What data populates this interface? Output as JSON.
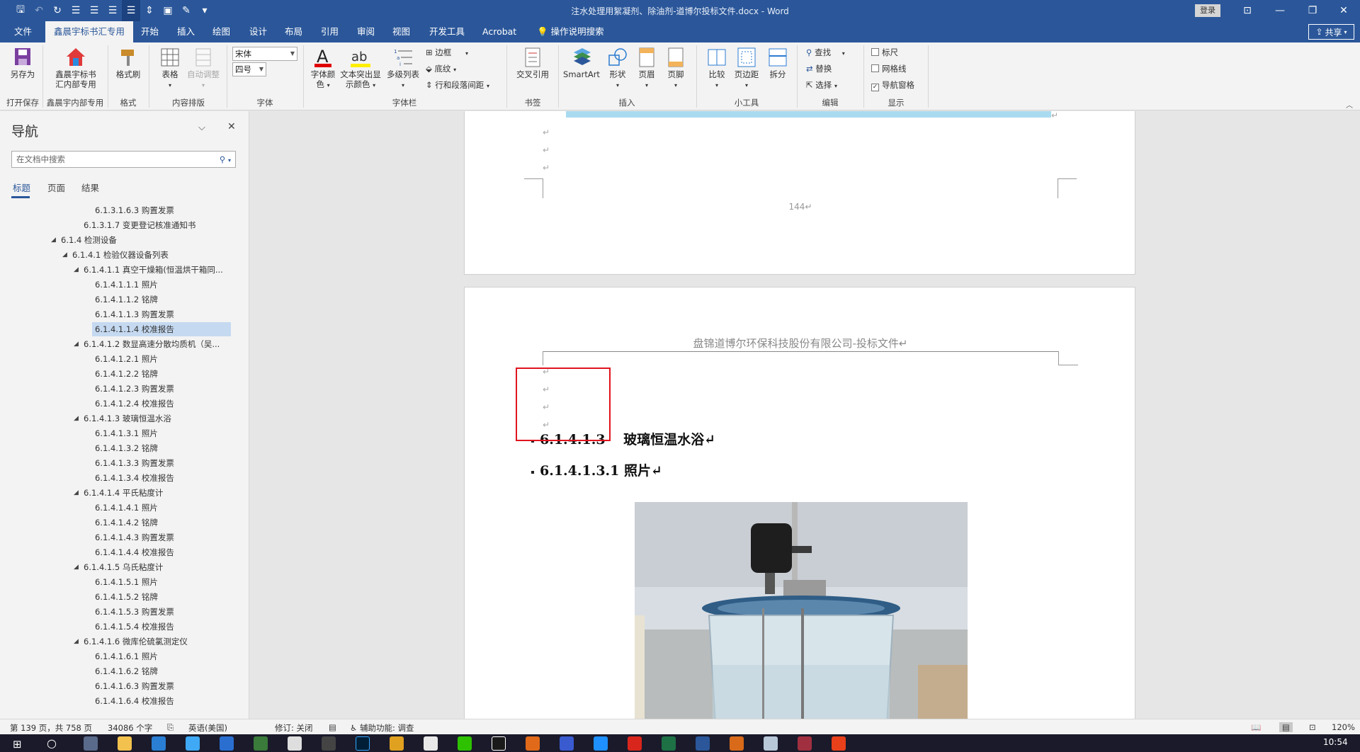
{
  "window": {
    "title": "注水处理用絮凝剂、除油剂-道博尔投标文件.docx  -  Word",
    "login": "登录",
    "share": "共享"
  },
  "tabs": [
    "文件",
    "鑫晨宇标书汇专用",
    "开始",
    "插入",
    "绘图",
    "设计",
    "布局",
    "引用",
    "审阅",
    "视图",
    "开发工具",
    "Acrobat",
    "操作说明搜索"
  ],
  "ribbon": {
    "saveas": "另存为",
    "xcy_line1": "鑫晨宇标书",
    "xcy_line2": "汇内部专用",
    "formatpainter": "格式刷",
    "table": "表格",
    "autoadjust": "自动调整",
    "font_name": "宋体",
    "font_size": "四号",
    "fontcolor_l1": "字体颜",
    "fontcolor_l2": "色",
    "highlight_l1": "文本突出显",
    "highlight_l2": "示颜色",
    "multilevel": "多级列表",
    "border": "边框",
    "shading": "底纹",
    "linespacing": "行和段落间距",
    "crossref": "交叉引用",
    "smartart": "SmartArt",
    "shapes": "形状",
    "header": "页眉",
    "footer": "页脚",
    "compare": "比较",
    "margins": "页边距",
    "split": "拆分",
    "find": "查找",
    "replace": "替换",
    "select": "选择",
    "ruler": "标尺",
    "gridlines": "网格线",
    "navpane": "导航窗格",
    "groups": {
      "open": "打开保存",
      "xcy": "鑫晨宇内部专用",
      "format": "格式",
      "layout": "内容排版",
      "font": "字体",
      "para": "字体栏",
      "bookmark": "书签",
      "insert": "插入",
      "tools": "小工具",
      "edit": "编辑",
      "show": "显示"
    }
  },
  "nav": {
    "title": "导航",
    "search_placeholder": "在文档中搜索",
    "tabs": [
      "标题",
      "页面",
      "结果"
    ],
    "items": [
      {
        "label": "6.1.3.1.6.3 购置发票"
      },
      {
        "label": "6.1.3.1.7 变更登记核准通知书"
      },
      {
        "label": "6.1.4 检测设备"
      },
      {
        "label": "6.1.4.1 检验仪器设备列表"
      },
      {
        "label": "6.1.4.1.1 真空干燥箱(恒温烘干箱同..."
      },
      {
        "label": "6.1.4.1.1.1 照片"
      },
      {
        "label": "6.1.4.1.1.2 铭牌"
      },
      {
        "label": "6.1.4.1.1.3 购置发票"
      },
      {
        "label": "6.1.4.1.1.4 校准报告"
      },
      {
        "label": "6.1.4.1.2 数显高速分散均质机（吴..."
      },
      {
        "label": "6.1.4.1.2.1 照片"
      },
      {
        "label": "6.1.4.1.2.2 铭牌"
      },
      {
        "label": "6.1.4.1.2.3 购置发票"
      },
      {
        "label": "6.1.4.1.2.4 校准报告"
      },
      {
        "label": "6.1.4.1.3 玻璃恒温水浴"
      },
      {
        "label": "6.1.4.1.3.1 照片"
      },
      {
        "label": "6.1.4.1.3.2 铭牌"
      },
      {
        "label": "6.1.4.1.3.3 购置发票"
      },
      {
        "label": "6.1.4.1.3.4 校准报告"
      },
      {
        "label": "6.1.4.1.4 平氏粘度计"
      },
      {
        "label": "6.1.4.1.4.1 照片"
      },
      {
        "label": "6.1.4.1.4.2 铭牌"
      },
      {
        "label": "6.1.4.1.4.3 购置发票"
      },
      {
        "label": "6.1.4.1.4.4 校准报告"
      },
      {
        "label": "6.1.4.1.5 乌氏粘度计"
      },
      {
        "label": "6.1.4.1.5.1 照片"
      },
      {
        "label": "6.1.4.1.5.2 铭牌"
      },
      {
        "label": "6.1.4.1.5.3 购置发票"
      },
      {
        "label": "6.1.4.1.5.4 校准报告"
      },
      {
        "label": "6.1.4.1.6 微库伦硫氯测定仪"
      },
      {
        "label": "6.1.4.1.6.1 照片"
      },
      {
        "label": "6.1.4.1.6.2 铭牌"
      },
      {
        "label": "6.1.4.1.6.3 购置发票"
      },
      {
        "label": "6.1.4.1.6.4 校准报告"
      }
    ]
  },
  "document": {
    "page_number": "144↵",
    "header_text": "盘锦道博尔环保科技股份有限公司-投标文件↵",
    "paragraph_mark": "↵",
    "heading1": "6.1.4.1.3　 玻璃恒温水浴↵",
    "heading2": "6.1.4.1.3.1 照片↵"
  },
  "status": {
    "page": "第 139 页，共 758 页",
    "words": "34086 个字",
    "lang": "英语(美国)",
    "revision": "修订: 关闭",
    "accessibility": "辅助功能: 调查",
    "zoom": "120%"
  },
  "taskbar": {
    "time": "10:54"
  }
}
